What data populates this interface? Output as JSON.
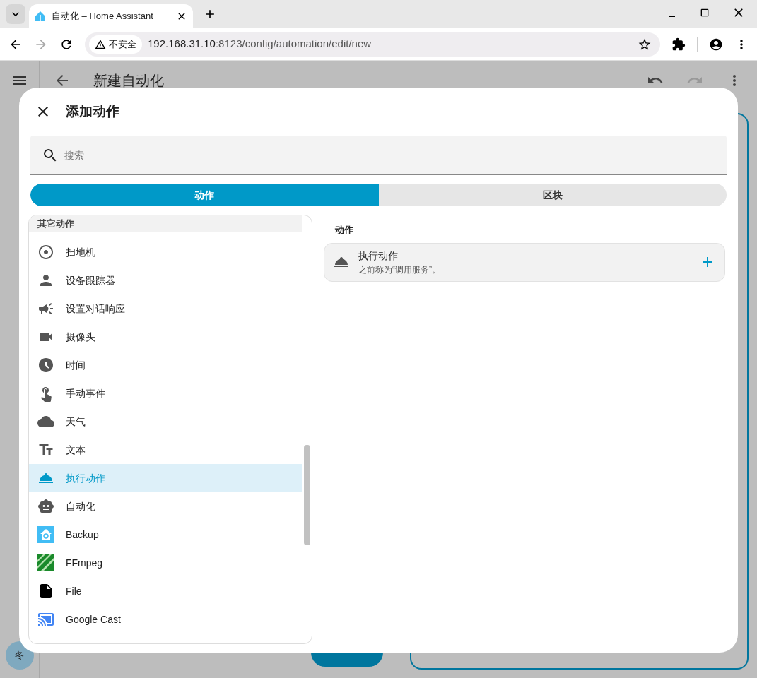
{
  "browser": {
    "tab_title": "自动化 – Home Assistant",
    "security": "不安全",
    "url_host": "192.168.31.10",
    "url_rest": ":8123/config/automation/edit/new"
  },
  "page": {
    "title": "新建自动化"
  },
  "user": {
    "avatar": "冬"
  },
  "dialog": {
    "title": "添加动作",
    "search": {
      "placeholder": "搜索"
    },
    "tabs": [
      {
        "label": "动作",
        "selected": true
      },
      {
        "label": "区块",
        "selected": false
      }
    ],
    "group": "其它动作",
    "items": [
      {
        "label": "扫地机",
        "selected": false
      },
      {
        "label": "设备跟踪器",
        "selected": false
      },
      {
        "label": "设置对话响应",
        "selected": false
      },
      {
        "label": "摄像头",
        "selected": false
      },
      {
        "label": "时间",
        "selected": false
      },
      {
        "label": "手动事件",
        "selected": false
      },
      {
        "label": "天气",
        "selected": false
      },
      {
        "label": "文本",
        "selected": false
      },
      {
        "label": "执行动作",
        "selected": true
      },
      {
        "label": "自动化",
        "selected": false
      },
      {
        "label": "Backup",
        "selected": false
      },
      {
        "label": "FFmpeg",
        "selected": false
      },
      {
        "label": "File",
        "selected": false
      },
      {
        "label": "Google Cast",
        "selected": false
      }
    ],
    "section_title": "动作",
    "cards": [
      {
        "title": "执行动作",
        "subtitle": "之前称为“调用服务”。"
      }
    ]
  }
}
